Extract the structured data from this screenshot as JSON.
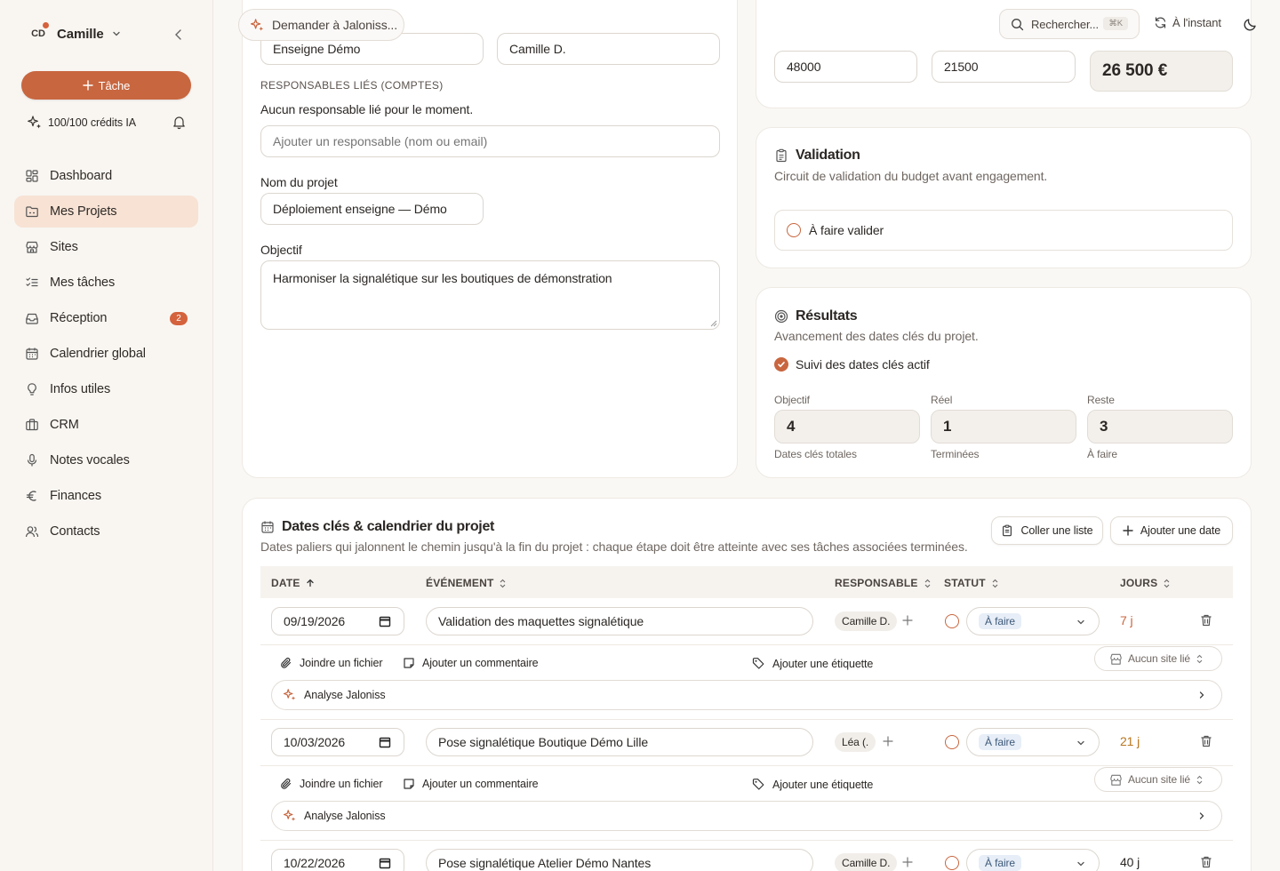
{
  "sidebar": {
    "user_initials": "CD",
    "user_name": "Camille",
    "task_button": "Tâche",
    "credits": "100/100 crédits IA",
    "items": [
      {
        "label": "Dashboard"
      },
      {
        "label": "Mes Projets",
        "active": true
      },
      {
        "label": "Sites"
      },
      {
        "label": "Mes tâches"
      },
      {
        "label": "Réception",
        "badge": "2"
      },
      {
        "label": "Calendrier global"
      },
      {
        "label": "Infos utiles"
      },
      {
        "label": "CRM"
      },
      {
        "label": "Notes vocales"
      },
      {
        "label": "Finances"
      },
      {
        "label": "Contacts"
      }
    ]
  },
  "topbar": {
    "ask_placeholder": "Demander à Jaloniss...",
    "search_placeholder": "Rechercher...",
    "search_kbd": "⌘K",
    "sync_status": "À l'instant"
  },
  "project": {
    "enseigne_value": "Enseigne Démo",
    "owner_value": "Camille D.",
    "linked_label": "RESPONSABLES LIÉS (COMPTES)",
    "linked_empty": "Aucun responsable lié pour le moment.",
    "linked_placeholder": "Ajouter un responsable (nom ou email)",
    "name_label": "Nom du projet",
    "name_value": "Déploiement enseigne — Démo",
    "objective_label": "Objectif",
    "objective_value": "Harmoniser la signalétique sur les boutiques de démonstration"
  },
  "budget": {
    "planned": "48000",
    "actual": "21500",
    "remaining": "26 500 €"
  },
  "validation": {
    "title": "Validation",
    "subtitle": "Circuit de validation du budget avant engagement.",
    "option": "À faire valider"
  },
  "results": {
    "title": "Résultats",
    "subtitle": "Avancement des dates clés du projet.",
    "toggle_label": "Suivi des dates clés actif",
    "metrics": [
      {
        "label": "Objectif",
        "value": "4",
        "caption": "Dates clés totales"
      },
      {
        "label": "Réel",
        "value": "1",
        "caption": "Terminées"
      },
      {
        "label": "Reste",
        "value": "3",
        "caption": "À faire"
      }
    ]
  },
  "dates": {
    "title": "Dates clés & calendrier du projet",
    "subtitle": "Dates paliers qui jalonnent le chemin jusqu'à la fin du projet : chaque étape doit être atteinte avec ses tâches associées terminées.",
    "paste_button": "Coller une liste",
    "add_button": "Ajouter une date",
    "columns": [
      "DATE",
      "ÉVÉNEMENT",
      "RESPONSABLE",
      "STATUT",
      "JOURS"
    ],
    "attach_label": "Joindre un fichier",
    "comment_label": "Ajouter un commentaire",
    "tag_label": "Ajouter une étiquette",
    "site_label": "Aucun site lié",
    "ai_label": "Analyse Jaloniss",
    "rows": [
      {
        "date": "09/19/2026",
        "event": "Validation des maquettes signalétique",
        "owner": "Camille D.",
        "status": "À faire",
        "days": "7 j",
        "days_color": "#c8663f"
      },
      {
        "date": "10/03/2026",
        "event": "Pose signalétique Boutique Démo Lille",
        "owner": "Léa (.",
        "status": "À faire",
        "days": "21 j",
        "days_color": "#b8761f"
      },
      {
        "date": "10/22/2026",
        "event": "Pose signalétique Atelier Démo Nantes",
        "owner": "Camille D.",
        "status": "À faire",
        "days": "40 j",
        "days_color": "#2b2724"
      }
    ]
  }
}
